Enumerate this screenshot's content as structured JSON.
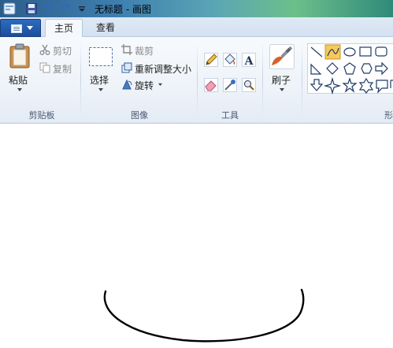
{
  "window": {
    "title": "无标题 - 画图"
  },
  "tabs": {
    "home": "主页",
    "view": "查看"
  },
  "clipboard": {
    "paste": "粘贴",
    "cut": "剪切",
    "copy": "复制",
    "group": "剪贴板"
  },
  "image": {
    "select": "选择",
    "crop": "裁剪",
    "resize": "重新调整大小",
    "rotate": "旋转",
    "group": "图像"
  },
  "tools": {
    "group": "工具"
  },
  "brushes": {
    "label": "刷子"
  },
  "shapes": {
    "group_partial": "形"
  },
  "colors": {
    "accent": "#2d6cc0",
    "selected_shape": "#f6c95a"
  }
}
